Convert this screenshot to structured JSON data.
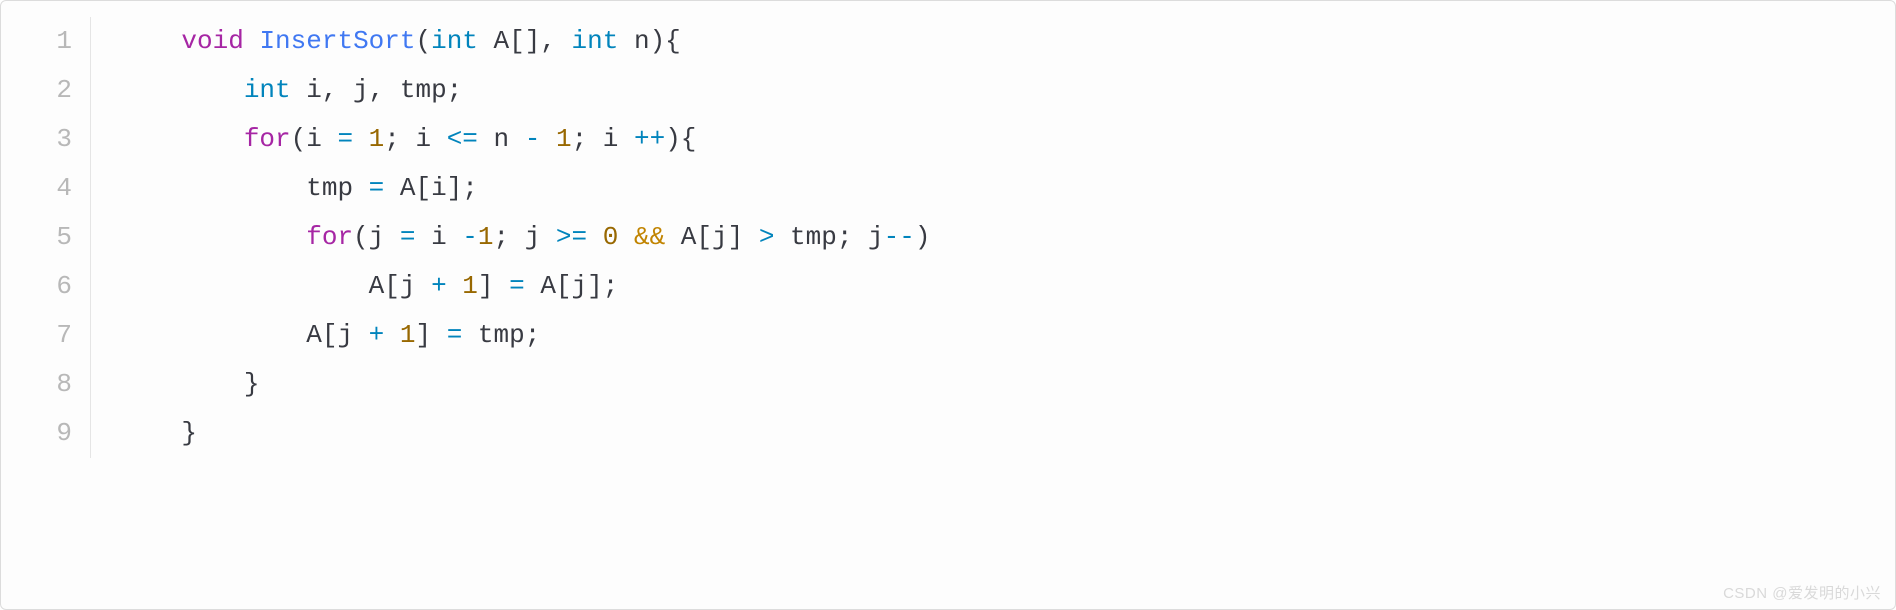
{
  "watermark": "CSDN @爱发明的小兴",
  "lines": [
    {
      "num": "1",
      "indent": "    ",
      "tokens": [
        {
          "t": "void",
          "c": "tok-keyword"
        },
        {
          "t": " ",
          "c": "tok-plain"
        },
        {
          "t": "InsertSort",
          "c": "tok-funcname"
        },
        {
          "t": "(",
          "c": "tok-plain"
        },
        {
          "t": "int",
          "c": "tok-type"
        },
        {
          "t": " A[], ",
          "c": "tok-plain"
        },
        {
          "t": "int",
          "c": "tok-type"
        },
        {
          "t": " n",
          "c": "tok-plain"
        },
        {
          "t": ")",
          "c": "tok-plain"
        },
        {
          "t": "{",
          "c": "tok-plain"
        }
      ]
    },
    {
      "num": "2",
      "indent": "        ",
      "tokens": [
        {
          "t": "int",
          "c": "tok-type"
        },
        {
          "t": " i, j, tmp;",
          "c": "tok-plain"
        }
      ]
    },
    {
      "num": "3",
      "indent": "        ",
      "tokens": [
        {
          "t": "for",
          "c": "tok-keyword"
        },
        {
          "t": "(i ",
          "c": "tok-plain"
        },
        {
          "t": "=",
          "c": "tok-operator"
        },
        {
          "t": " ",
          "c": "tok-plain"
        },
        {
          "t": "1",
          "c": "tok-number"
        },
        {
          "t": "; i ",
          "c": "tok-plain"
        },
        {
          "t": "<=",
          "c": "tok-operator"
        },
        {
          "t": " n ",
          "c": "tok-plain"
        },
        {
          "t": "-",
          "c": "tok-operator"
        },
        {
          "t": " ",
          "c": "tok-plain"
        },
        {
          "t": "1",
          "c": "tok-number"
        },
        {
          "t": "; i ",
          "c": "tok-plain"
        },
        {
          "t": "++",
          "c": "tok-operator"
        },
        {
          "t": "){",
          "c": "tok-plain"
        }
      ]
    },
    {
      "num": "4",
      "indent": "            ",
      "tokens": [
        {
          "t": "tmp ",
          "c": "tok-plain"
        },
        {
          "t": "=",
          "c": "tok-operator"
        },
        {
          "t": " A[i];",
          "c": "tok-plain"
        }
      ]
    },
    {
      "num": "5",
      "indent": "            ",
      "tokens": [
        {
          "t": "for",
          "c": "tok-keyword"
        },
        {
          "t": "(j ",
          "c": "tok-plain"
        },
        {
          "t": "=",
          "c": "tok-operator"
        },
        {
          "t": " i ",
          "c": "tok-plain"
        },
        {
          "t": "-",
          "c": "tok-operator"
        },
        {
          "t": "1",
          "c": "tok-number"
        },
        {
          "t": "; j ",
          "c": "tok-plain"
        },
        {
          "t": ">=",
          "c": "tok-operator"
        },
        {
          "t": " ",
          "c": "tok-plain"
        },
        {
          "t": "0",
          "c": "tok-number"
        },
        {
          "t": " ",
          "c": "tok-plain"
        },
        {
          "t": "&&",
          "c": "tok-logical"
        },
        {
          "t": " A[j] ",
          "c": "tok-plain"
        },
        {
          "t": ">",
          "c": "tok-operator"
        },
        {
          "t": " tmp; j",
          "c": "tok-plain"
        },
        {
          "t": "--",
          "c": "tok-operator"
        },
        {
          "t": ")",
          "c": "tok-plain"
        }
      ]
    },
    {
      "num": "6",
      "indent": "                ",
      "tokens": [
        {
          "t": "A[j ",
          "c": "tok-plain"
        },
        {
          "t": "+",
          "c": "tok-operator"
        },
        {
          "t": " ",
          "c": "tok-plain"
        },
        {
          "t": "1",
          "c": "tok-number"
        },
        {
          "t": "] ",
          "c": "tok-plain"
        },
        {
          "t": "=",
          "c": "tok-operator"
        },
        {
          "t": " A[j];",
          "c": "tok-plain"
        }
      ]
    },
    {
      "num": "7",
      "indent": "            ",
      "tokens": [
        {
          "t": "A[j ",
          "c": "tok-plain"
        },
        {
          "t": "+",
          "c": "tok-operator"
        },
        {
          "t": " ",
          "c": "tok-plain"
        },
        {
          "t": "1",
          "c": "tok-number"
        },
        {
          "t": "] ",
          "c": "tok-plain"
        },
        {
          "t": "=",
          "c": "tok-operator"
        },
        {
          "t": " tmp;",
          "c": "tok-plain"
        }
      ]
    },
    {
      "num": "8",
      "indent": "        ",
      "tokens": [
        {
          "t": "}",
          "c": "tok-plain"
        }
      ]
    },
    {
      "num": "9",
      "indent": "    ",
      "tokens": [
        {
          "t": "}",
          "c": "tok-plain"
        }
      ]
    }
  ]
}
